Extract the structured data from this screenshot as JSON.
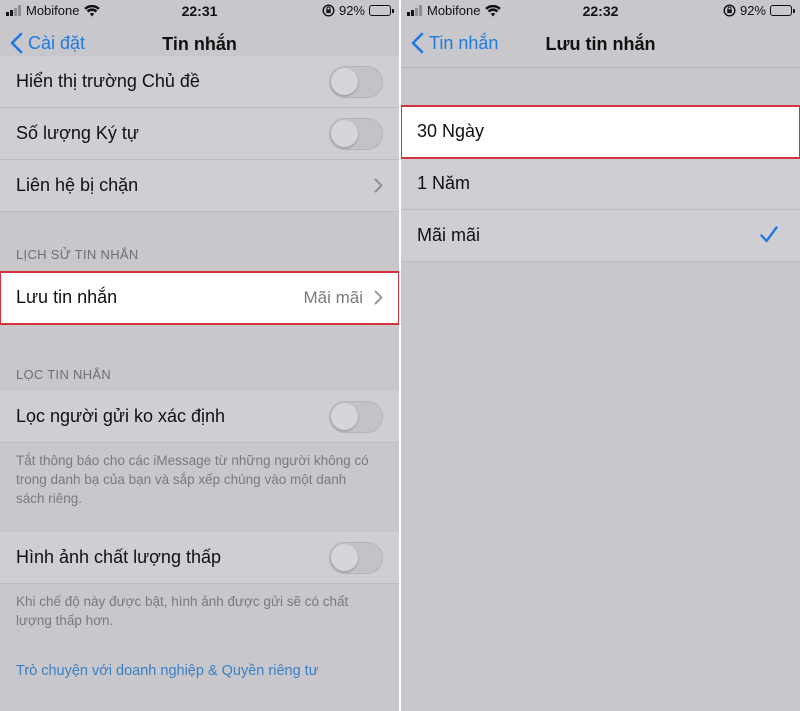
{
  "left": {
    "status": {
      "carrier": "Mobifone",
      "time": "22:31",
      "battery": "92%"
    },
    "nav": {
      "back_label": "Cài đặt",
      "title": "Tin nhắn"
    },
    "rows": {
      "show_subject": "Hiển thị trường Chủ đề",
      "char_count": "Số lượng Ký tự",
      "blocked": "Liên hệ bị chặn"
    },
    "history": {
      "header": "LỊCH SỬ TIN NHẮN",
      "keep_messages_label": "Lưu tin nhắn",
      "keep_messages_value": "Mãi mãi"
    },
    "filter": {
      "header": "LỌC TIN NHẮN",
      "unknown_senders": "Lọc người gửi ko xác định",
      "unknown_footer": "Tắt thông báo cho các iMessage từ những người không có trong danh bạ của bạn và sắp xếp chúng vào một danh sách riêng."
    },
    "low_quality": {
      "label": "Hình ảnh chất lượng thấp",
      "footer": "Khi chế độ này được bật, hình ảnh được gửi sẽ có chất lượng thấp hơn."
    },
    "privacy_link": "Trò chuyện với doanh nghiệp & Quyền riêng tư"
  },
  "right": {
    "status": {
      "carrier": "Mobifone",
      "time": "22:32",
      "battery": "92%"
    },
    "nav": {
      "back_label": "Tin nhắn",
      "title": "Lưu tin nhắn"
    },
    "options": [
      {
        "label": "30 Ngày",
        "selected": false
      },
      {
        "label": "1 Năm",
        "selected": false
      },
      {
        "label": "Mãi mãi",
        "selected": true
      }
    ]
  },
  "colors": {
    "accent": "#1f7ae0",
    "highlight_border": "#d6323b",
    "dim_bg": "#c8c7cc"
  }
}
